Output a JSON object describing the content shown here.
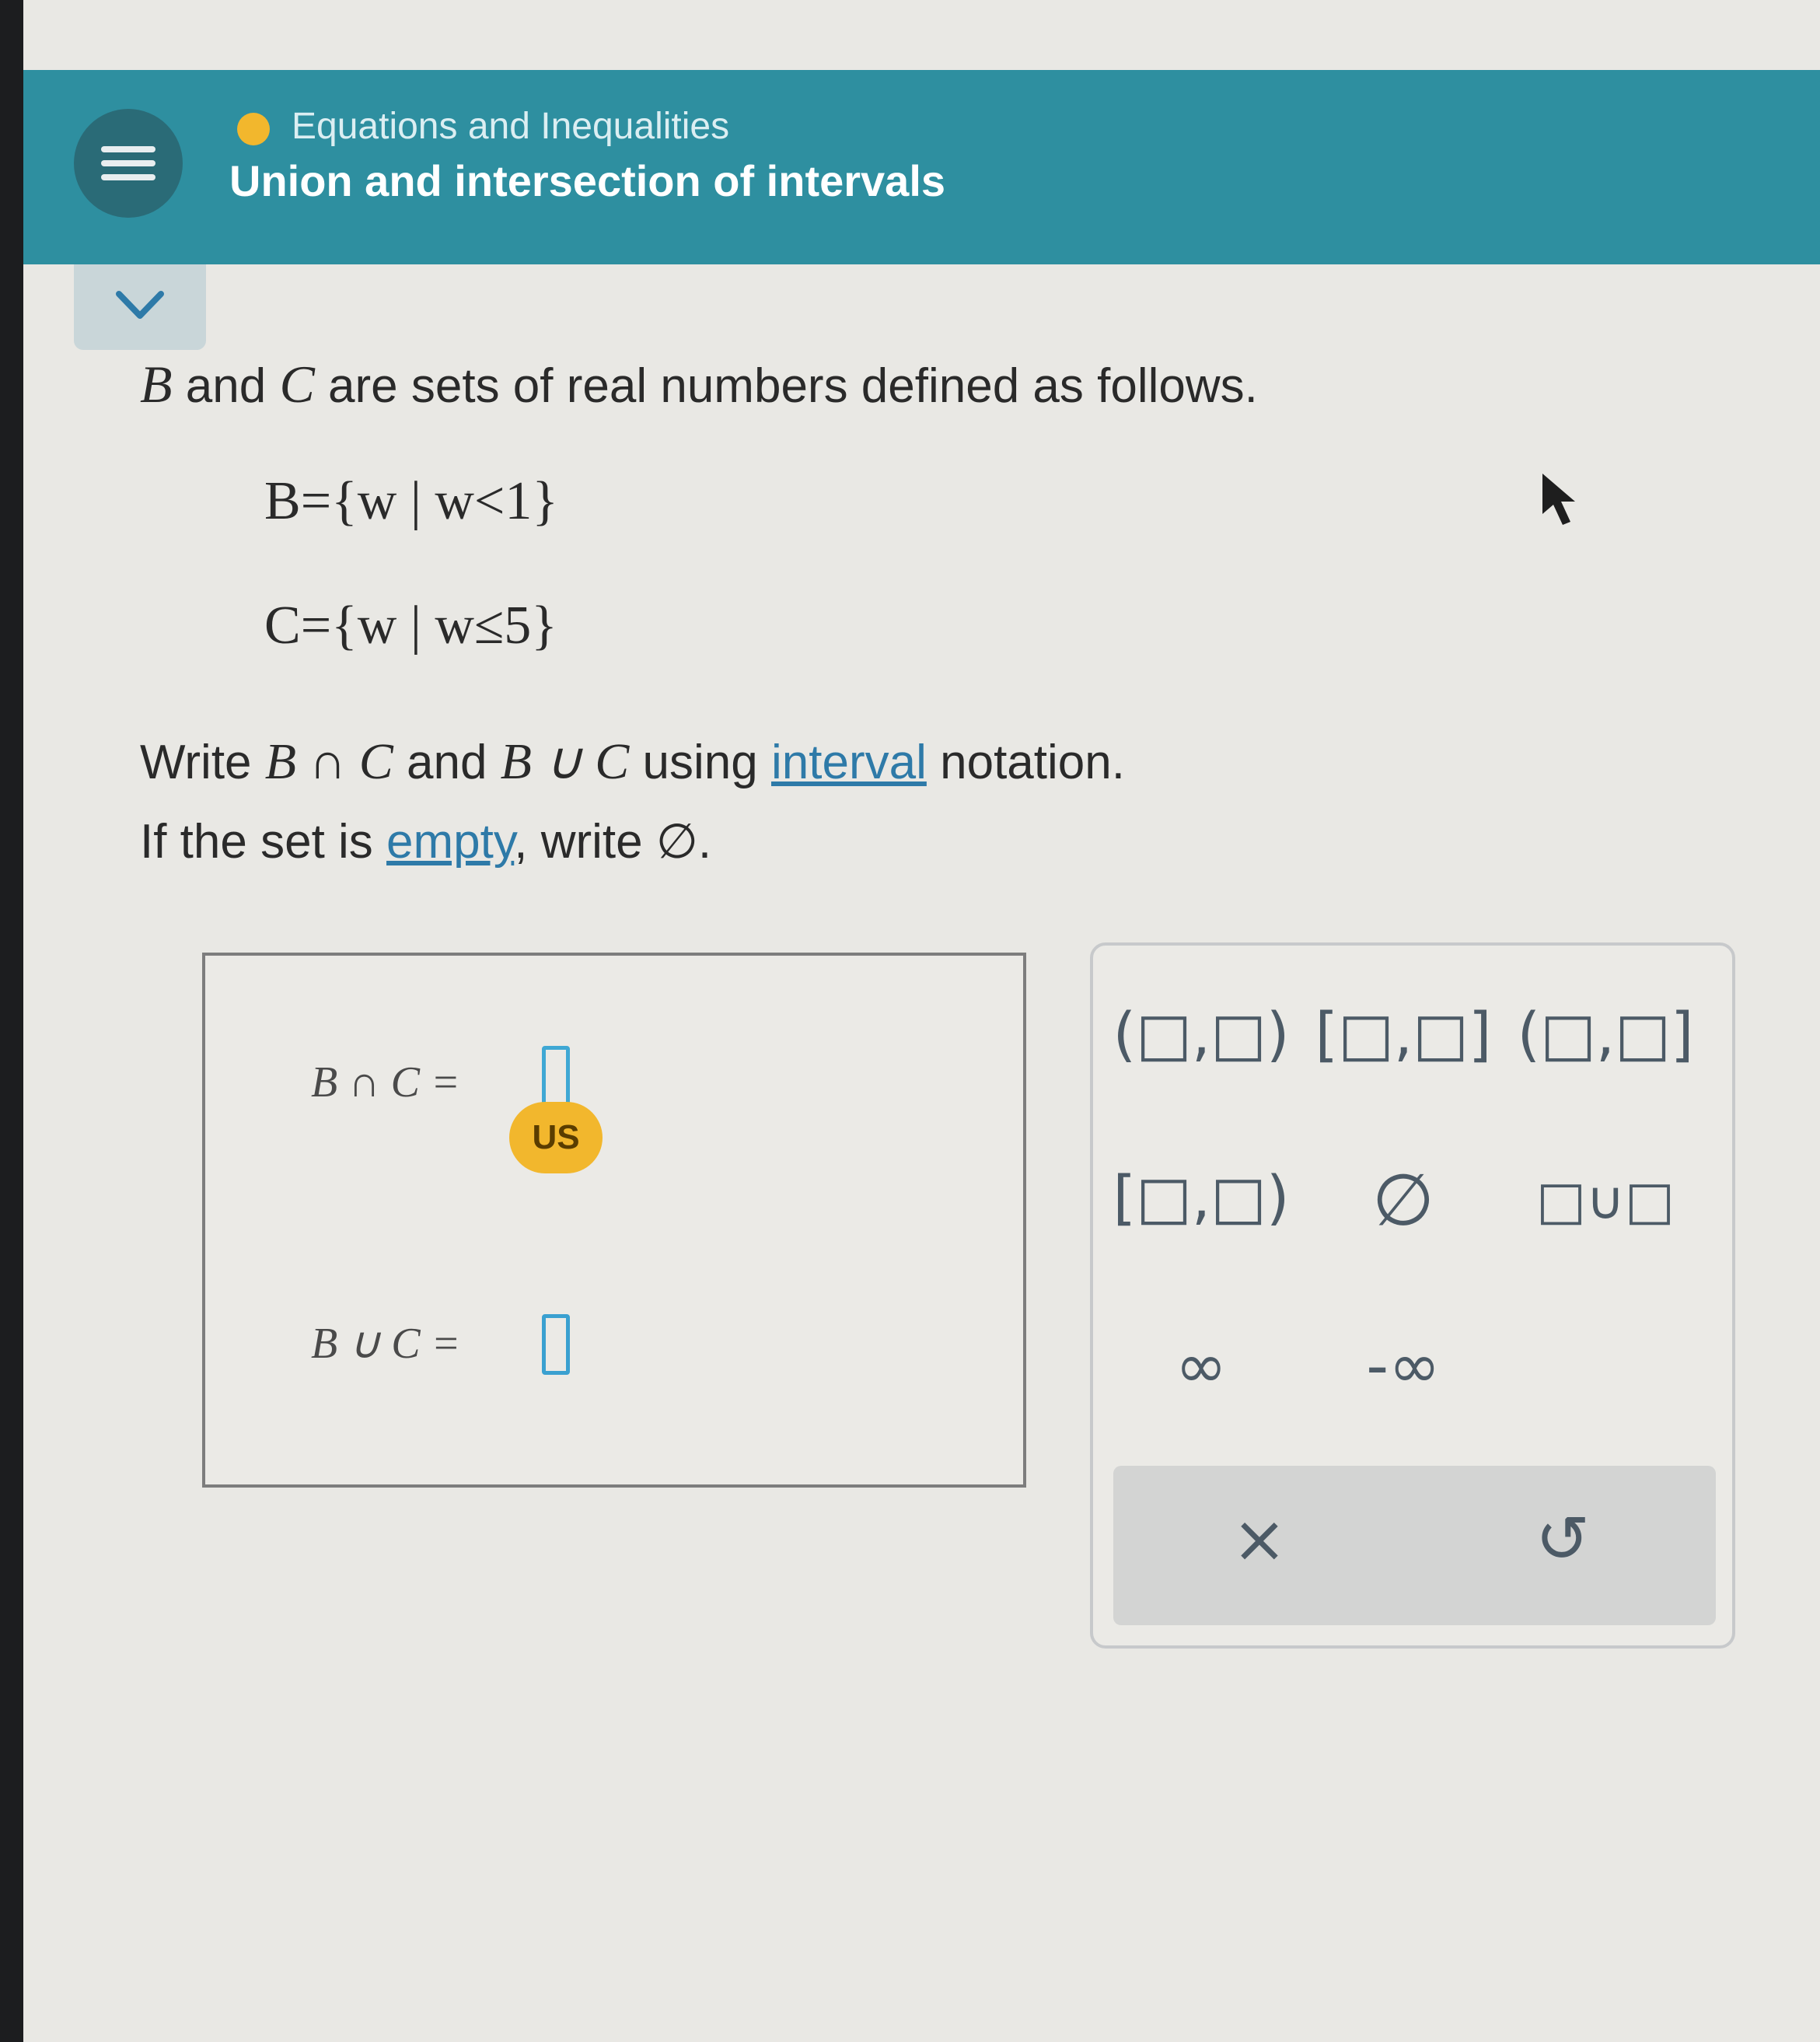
{
  "header": {
    "topic": "Equations and Inequalities",
    "title": "Union and intersection of intervals"
  },
  "problem": {
    "intro_b": "B",
    "intro_and": " and ",
    "intro_c": "C",
    "intro_rest": " are sets of real numbers defined as follows.",
    "set_b": "B={w | w<1}",
    "set_c": "C={w | w≤5}",
    "line3_pre": "Write ",
    "line3_expr1": "B ∩ C",
    "line3_and": " and ",
    "line3_expr2": "B ∪ C",
    "line3_using": " using ",
    "line3_link": "interval",
    "line3_post": " notation.",
    "line4_pre": "If the set is ",
    "line4_link": "empty",
    "line4_post": ", write ∅."
  },
  "answers": {
    "intersection_label": "B ∩ C =",
    "union_label": "B ∪ C =",
    "badge": "US"
  },
  "palette": {
    "open_open": "(□,□)",
    "closed_closed": "[□,□]",
    "open_closed": "(□,□]",
    "closed_open": "[□,□)",
    "empty_set": "∅",
    "union": "□∪□",
    "infinity": "∞",
    "neg_infinity": "-∞",
    "clear": "×",
    "undo": "↺"
  },
  "colors": {
    "header_bg": "#2e8fa0",
    "accent_yellow": "#f2b72d",
    "slot_blue": "#3fa8d4",
    "link_blue": "#2e7aa8"
  }
}
